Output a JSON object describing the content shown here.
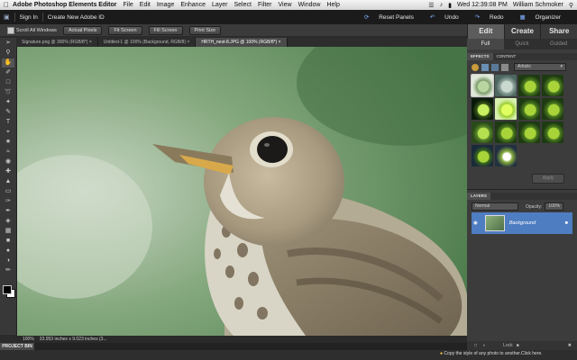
{
  "menubar": {
    "app_name": "Adobe Photoshop Elements Editor",
    "items": [
      "File",
      "Edit",
      "Image",
      "Enhance",
      "Layer",
      "Select",
      "Filter",
      "View",
      "Window",
      "Help"
    ],
    "clock": "Wed 12:39:08 PM",
    "user": "William Schmoker"
  },
  "appbar": {
    "sign_in": "Sign In",
    "create_id": "Create New Adobe ID",
    "reset_panels": "Reset Panels",
    "undo": "Undo",
    "redo": "Redo",
    "organizer": "Organizer"
  },
  "modes": {
    "edit": "Edit",
    "create": "Create",
    "share": "Share"
  },
  "submodes": {
    "full": "Full",
    "quick": "Quick",
    "guided": "Guided"
  },
  "options": {
    "scroll_all": "Scroll All Windows",
    "actual_pixels": "Actual Pixels",
    "fit_screen": "Fit Screen",
    "fill_screen": "Fill Screen",
    "print_size": "Print Size"
  },
  "doc_tabs": [
    "Signature.png @ 300% (RGB/8*) ×",
    "Untitled-1 @ 100% (Background, RGB/8) ×",
    "HRTH_nest-8.JPG @ 100% (RGB/8*) ×"
  ],
  "effects": {
    "tab_effects": "EFFECTS",
    "tab_content": "CONTENT",
    "category": "Artistic",
    "apply": "Apply"
  },
  "layers": {
    "title": "LAYERS",
    "blend": "Normal",
    "opacity_label": "Opacity:",
    "opacity_value": "100%",
    "layer_name": "Background",
    "lock": "Lock"
  },
  "status": {
    "zoom": "100%",
    "dimensions": "33.953 inches x 9.023 inches (3..."
  },
  "project_bin": "PROJECT BIN",
  "tip": "Copy the style of any photo to another.Click here."
}
